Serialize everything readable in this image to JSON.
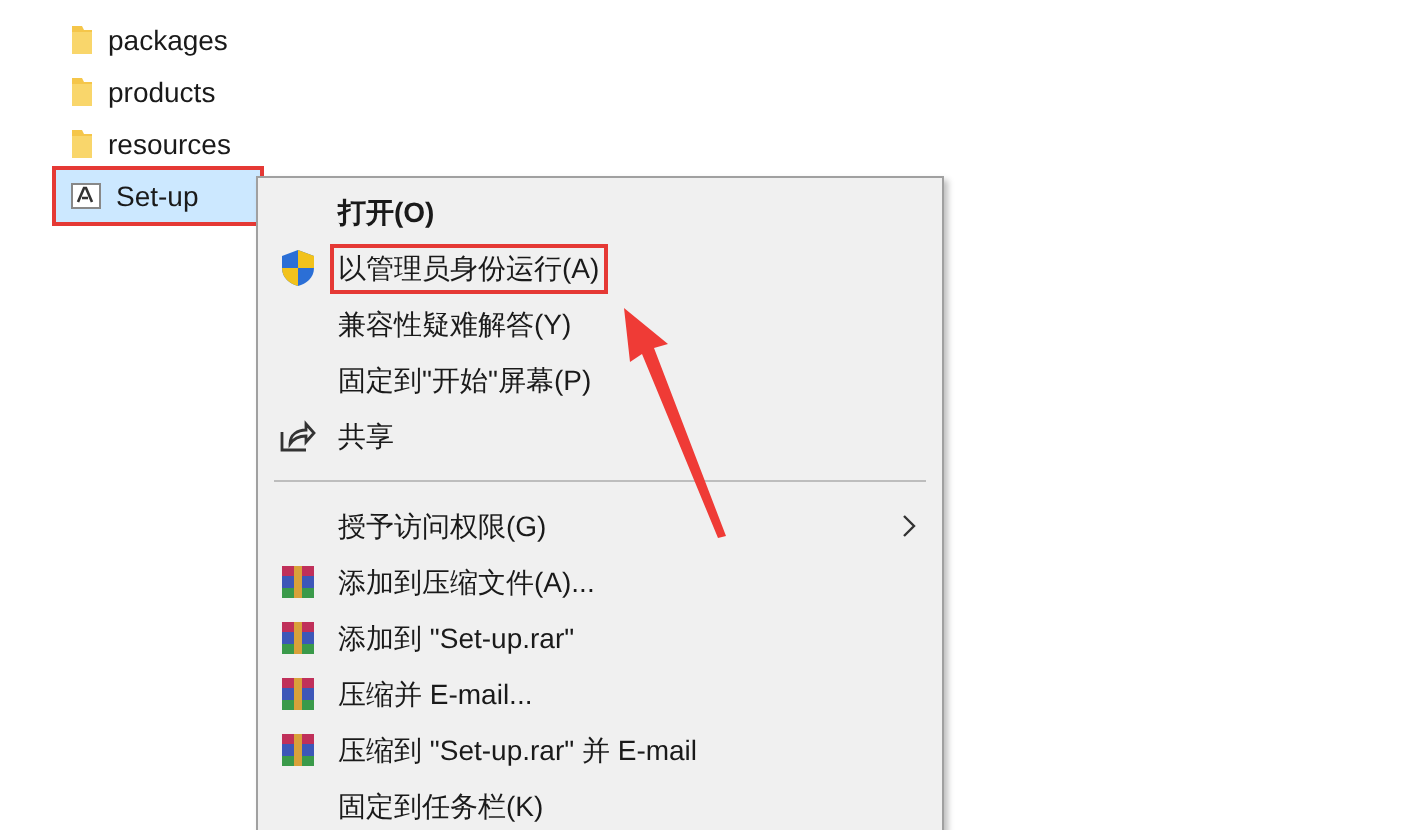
{
  "files": [
    {
      "name": "packages",
      "kind": "folder",
      "selected": false,
      "highlighted": false
    },
    {
      "name": "products",
      "kind": "folder",
      "selected": false,
      "highlighted": false
    },
    {
      "name": "resources",
      "kind": "folder",
      "selected": false,
      "highlighted": false
    },
    {
      "name": "Set-up",
      "kind": "app",
      "selected": true,
      "highlighted": true
    }
  ],
  "context_menu": {
    "items": [
      {
        "kind": "plain",
        "label": "打开(O)",
        "bold": true,
        "highlighted": false
      },
      {
        "kind": "shield",
        "label": "以管理员身份运行(A)",
        "bold": false,
        "highlighted": true
      },
      {
        "kind": "plain",
        "label": "兼容性疑难解答(Y)",
        "bold": false,
        "highlighted": false
      },
      {
        "kind": "plain",
        "label": "固定到\"开始\"屏幕(P)",
        "bold": false,
        "highlighted": false
      },
      {
        "kind": "share",
        "label": "共享",
        "bold": false,
        "highlighted": false
      },
      {
        "kind": "separator"
      },
      {
        "kind": "submenu",
        "label": "授予访问权限(G)",
        "bold": false,
        "highlighted": false
      },
      {
        "kind": "archive",
        "label": "添加到压缩文件(A)...",
        "bold": false,
        "highlighted": false
      },
      {
        "kind": "archive",
        "label": "添加到 \"Set-up.rar\"",
        "bold": false,
        "highlighted": false
      },
      {
        "kind": "archive",
        "label": "压缩并 E-mail...",
        "bold": false,
        "highlighted": false
      },
      {
        "kind": "archive",
        "label": "压缩到 \"Set-up.rar\" 并 E-mail",
        "bold": false,
        "highlighted": false
      },
      {
        "kind": "plain",
        "label": "固定到任务栏(K)",
        "bold": false,
        "highlighted": false
      }
    ]
  }
}
